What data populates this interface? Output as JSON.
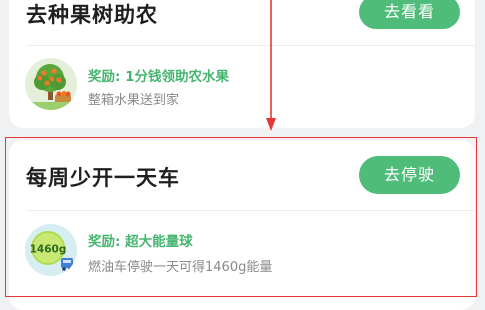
{
  "colors": {
    "accent": "#4fbc7a",
    "reward_text": "#47b56f",
    "annotation": "#e53935"
  },
  "cards": [
    {
      "title": "去种果树助农",
      "button": "去看看",
      "reward_title": "奖励: 1分钱领助农水果",
      "reward_desc": "整箱水果送到家",
      "icon": "fruit-tree-icon"
    },
    {
      "title": "每周少开一天车",
      "button": "去停驶",
      "reward_title": "奖励: 超大能量球",
      "reward_desc": "燃油车停驶一天可得1460g能量",
      "icon": "energy-ball-icon",
      "icon_label": "1460g"
    }
  ]
}
